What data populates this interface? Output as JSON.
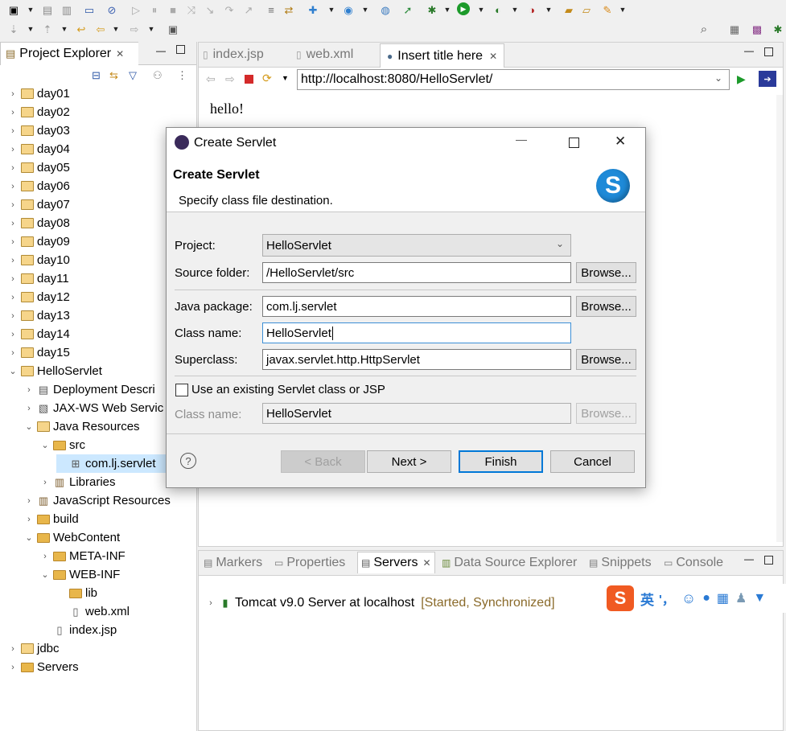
{
  "explorer": {
    "title": "Project Explorer",
    "items": [
      {
        "label": "day01"
      },
      {
        "label": "day02"
      },
      {
        "label": "day03"
      },
      {
        "label": "day04"
      },
      {
        "label": "day05"
      },
      {
        "label": "day06"
      },
      {
        "label": "day07"
      },
      {
        "label": "day08"
      },
      {
        "label": "day09"
      },
      {
        "label": "day10"
      },
      {
        "label": "day11"
      },
      {
        "label": "day12"
      },
      {
        "label": "day13"
      },
      {
        "label": "day14"
      },
      {
        "label": "day15"
      },
      {
        "label": "HelloServlet"
      },
      {
        "label": "Deployment Descri"
      },
      {
        "label": "JAX-WS Web Servic"
      },
      {
        "label": "Java Resources"
      },
      {
        "label": "src"
      },
      {
        "label": "com.lj.servlet"
      },
      {
        "label": "Libraries"
      },
      {
        "label": "JavaScript Resources"
      },
      {
        "label": "build"
      },
      {
        "label": "WebContent"
      },
      {
        "label": "META-INF"
      },
      {
        "label": "WEB-INF"
      },
      {
        "label": "lib"
      },
      {
        "label": "web.xml"
      },
      {
        "label": "index.jsp"
      },
      {
        "label": "jdbc"
      },
      {
        "label": "Servers"
      }
    ]
  },
  "editor": {
    "tabs": [
      {
        "label": "index.jsp"
      },
      {
        "label": "web.xml"
      },
      {
        "label": "Insert title here"
      }
    ],
    "url": "http://localhost:8080/HelloServlet/",
    "content": "hello!"
  },
  "bottom": {
    "tabs": [
      {
        "label": "Markers"
      },
      {
        "label": "Properties"
      },
      {
        "label": "Servers"
      },
      {
        "label": "Data Source Explorer"
      },
      {
        "label": "Snippets"
      },
      {
        "label": "Console"
      }
    ],
    "server_name": "Tomcat v9.0 Server at localhost",
    "server_status": "[Started, Synchronized]"
  },
  "ime": {
    "lang": "英",
    "punct": "'，"
  },
  "dialog": {
    "title": "Create Servlet",
    "heading": "Create Servlet",
    "subheading": "Specify class file destination.",
    "project_label": "Project:",
    "project_value": "HelloServlet",
    "source_folder_label": "Source folder:",
    "source_folder_value": "/HelloServlet/src",
    "java_package_label": "Java package:",
    "java_package_value": "com.lj.servlet",
    "class_name_label": "Class name:",
    "class_name_value": "HelloServlet",
    "superclass_label": "Superclass:",
    "superclass_value": "javax.servlet.http.HttpServlet",
    "browse": "Browse...",
    "existing_checkbox_label": "Use an existing Servlet class or JSP",
    "existing_class_label": "Class name:",
    "existing_class_value": "HelloServlet",
    "back": "< Back",
    "next": "Next >",
    "finish": "Finish",
    "cancel": "Cancel"
  }
}
